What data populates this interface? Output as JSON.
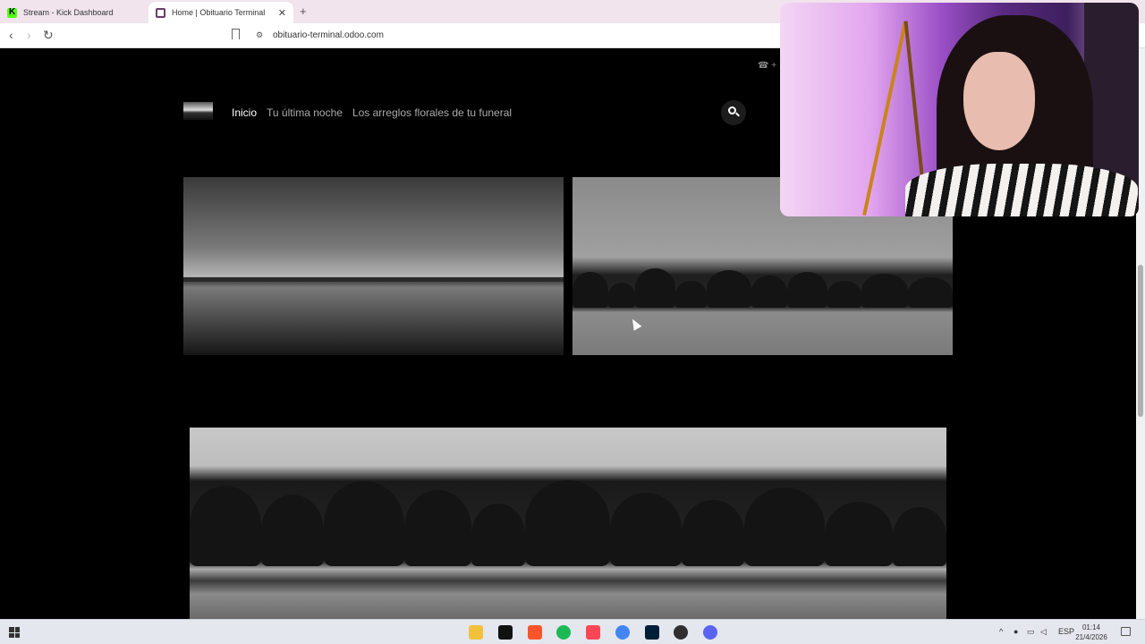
{
  "browser": {
    "tabs": [
      {
        "label": "Stream - Kick Dashboard",
        "active": false
      },
      {
        "label": "Home | Obituario Terminal",
        "active": true
      }
    ],
    "new_tab": "+",
    "close_tab": "✕",
    "url": "obituario-terminal.odoo.com",
    "back": "‹",
    "forward": "›",
    "reload": "↻"
  },
  "site": {
    "phone_text": "+",
    "nav": [
      {
        "label": "Inicio",
        "active": true
      },
      {
        "label": "Tu última noche",
        "active": false
      },
      {
        "label": "Los arreglos florales de tu funeral",
        "active": false
      }
    ]
  },
  "taskbar": {
    "tray_lang": "ESP",
    "time": "01:14",
    "date": "21/4/2026",
    "tray_up": "^",
    "apps": [
      {
        "name": "file-explorer-icon",
        "color": "#f2c13c"
      },
      {
        "name": "capcut-icon",
        "color": "#111111"
      },
      {
        "name": "brave-icon",
        "color": "#fb542b"
      },
      {
        "name": "spotify-icon",
        "color": "#1db954"
      },
      {
        "name": "valorant-icon",
        "color": "#ff4655"
      },
      {
        "name": "chrome-icon",
        "color": "#4285f4"
      },
      {
        "name": "photoshop-icon",
        "color": "#001e36"
      },
      {
        "name": "obs-icon",
        "color": "#302e31"
      },
      {
        "name": "discord-icon",
        "color": "#5865f2"
      }
    ]
  },
  "colors": {
    "page_bg": "#000000",
    "nav_active": "#ffffff",
    "nav_inactive": "#aaaaaa",
    "tabbar_bg": "#f1e4ec"
  }
}
